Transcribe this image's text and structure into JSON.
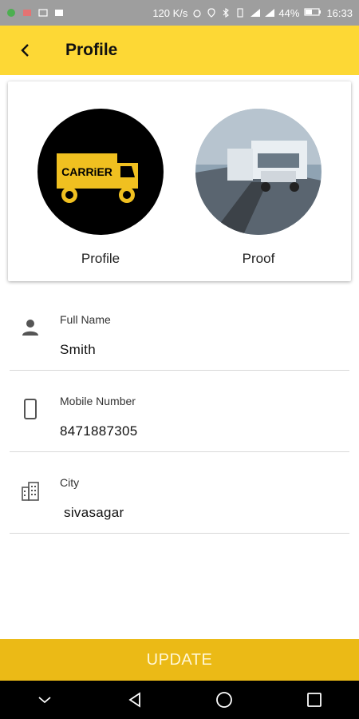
{
  "status_bar": {
    "network_speed": "120 K/s",
    "battery": "44%",
    "time": "16:33"
  },
  "app_bar": {
    "title": "Profile",
    "back_icon": "arrow-left-icon"
  },
  "images": {
    "profile_caption": "Profile",
    "proof_caption": "Proof",
    "logo_text": "CARRiER"
  },
  "fields": {
    "full_name": {
      "label": "Full Name",
      "value": "Smith",
      "icon": "person-icon"
    },
    "mobile": {
      "label": "Mobile Number",
      "value": "8471887305",
      "icon": "phone-icon"
    },
    "city": {
      "label": "City",
      "value": " sivasagar",
      "icon": "city-icon"
    }
  },
  "actions": {
    "update_label": "UPDATE"
  },
  "colors": {
    "accent": "#fdd835",
    "button": "#ebba16",
    "status_bar": "#9e9e9e"
  }
}
